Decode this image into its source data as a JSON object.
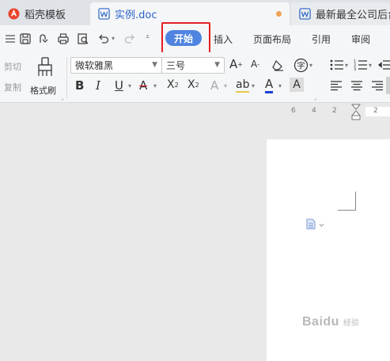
{
  "tabs": [
    {
      "label": "稻壳模板",
      "icon": "docer-icon"
    },
    {
      "label": "实例.doc",
      "icon": "word-doc-icon",
      "active": true,
      "unsaved": true
    },
    {
      "label": "最新最全公司后台",
      "icon": "word-doc-icon"
    }
  ],
  "menu": {
    "start": "开始",
    "insert": "插入",
    "layout": "页面布局",
    "references": "引用",
    "review": "审阅"
  },
  "ribbon": {
    "cut": "剪切",
    "copy": "复制",
    "format_painter": "格式刷",
    "font_name": "微软雅黑",
    "font_size": "三号"
  },
  "ruler": {
    "ticks": [
      "6",
      "4",
      "2",
      "2"
    ]
  },
  "watermark": {
    "text": "Baidu",
    "subtext": "经验"
  },
  "colors": {
    "accent": "#4f84e0",
    "highlight": "#e31e24",
    "font_color_underline": "#1a3fd6",
    "tab_active_text": "#2c64c8",
    "unsaved_dot": "#f0a257"
  }
}
